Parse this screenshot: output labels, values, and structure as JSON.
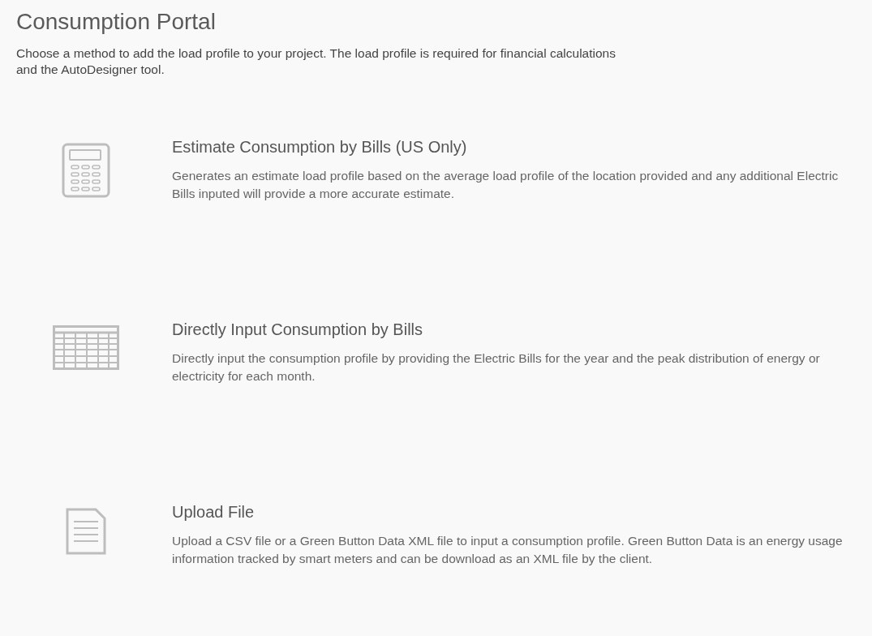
{
  "title": "Consumption Portal",
  "intro": "Choose a method to add the load profile to your project. The load profile is required for financial calculations and the AutoDesigner tool.",
  "options": [
    {
      "kind": "calculator",
      "heading": "Estimate Consumption by Bills (US Only)",
      "description": "Generates an estimate load profile based on the average load profile of the location provided and any additional Electric Bills inputed will provide a more accurate estimate."
    },
    {
      "kind": "table",
      "heading": "Directly Input Consumption by Bills",
      "description": "Directly input the consumption profile by providing the Electric Bills for the year and the peak distribution of energy or electricity for each month."
    },
    {
      "kind": "document",
      "heading": "Upload File",
      "description": "Upload a CSV file or a Green Button Data XML file to input a consumption profile. Green Button Data is an energy usage information tracked by smart meters and can be download as an XML file by the client."
    }
  ]
}
